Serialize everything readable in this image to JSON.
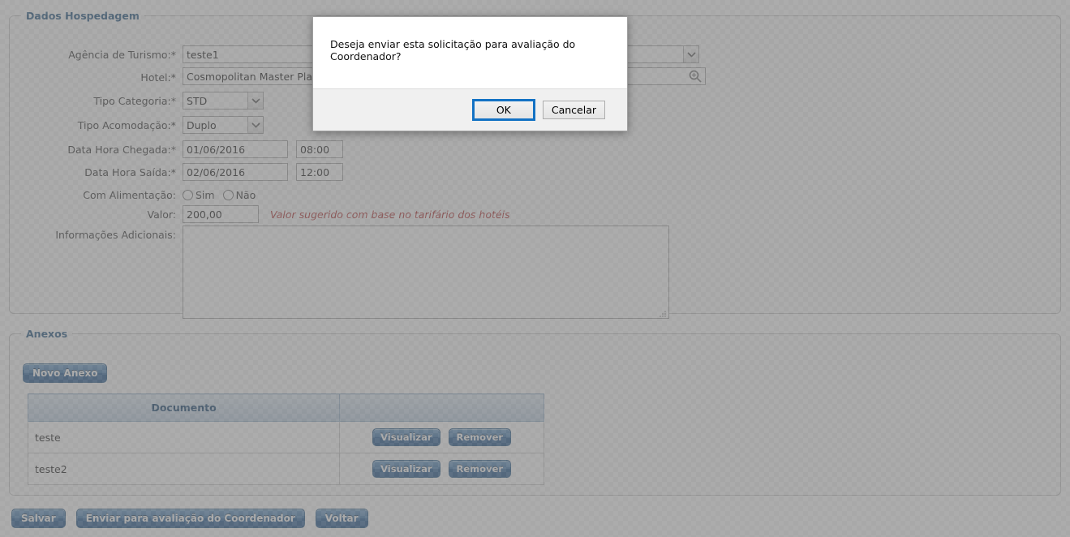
{
  "hospedagem": {
    "legend": "Dados Hospedagem",
    "fields": {
      "agencia_label": "Agência de Turismo:",
      "agencia_value": "teste1",
      "hotel_label": "Hotel:",
      "hotel_value": "Cosmopolitan Master Pla",
      "categoria_label": "Tipo Categoria:",
      "categoria_value": "STD",
      "acomodacao_label": "Tipo Acomodação:",
      "acomodacao_value": "Duplo",
      "chegada_label": "Data Hora Chegada:",
      "chegada_date": "01/06/2016",
      "chegada_time": "08:00",
      "saida_label": "Data Hora Saída:",
      "saida_date": "02/06/2016",
      "saida_time": "12:00",
      "alimentacao_label": "Com Alimentação:",
      "alimentacao_sim": "Sim",
      "alimentacao_nao": "Não",
      "valor_label": "Valor:",
      "valor_value": "200,00",
      "valor_hint": "Valor sugerido com base no tarifário dos hotéis",
      "info_label": "Informações Adicionais:",
      "info_value": ""
    },
    "required_mark": "*"
  },
  "anexos": {
    "legend": "Anexos",
    "new_button": "Novo Anexo",
    "columns": [
      "Documento",
      ""
    ],
    "rows": [
      {
        "documento": "teste",
        "view": "Visualizar",
        "remove": "Remover"
      },
      {
        "documento": "teste2",
        "view": "Visualizar",
        "remove": "Remover"
      }
    ]
  },
  "bottom_bar": {
    "salvar": "Salvar",
    "enviar": "Enviar para avaliação do Coordenador",
    "voltar": "Voltar"
  },
  "dialog": {
    "message": "Deseja enviar esta solicitação para avaliação do Coordenador?",
    "ok": "OK",
    "cancel": "Cancelar",
    "focus_color": "#1372c4"
  },
  "colors": {
    "legend": "#2a5a86",
    "hint": "#b43a3a",
    "button_blue": "#2f6399",
    "table_header": "#bed0e2"
  }
}
